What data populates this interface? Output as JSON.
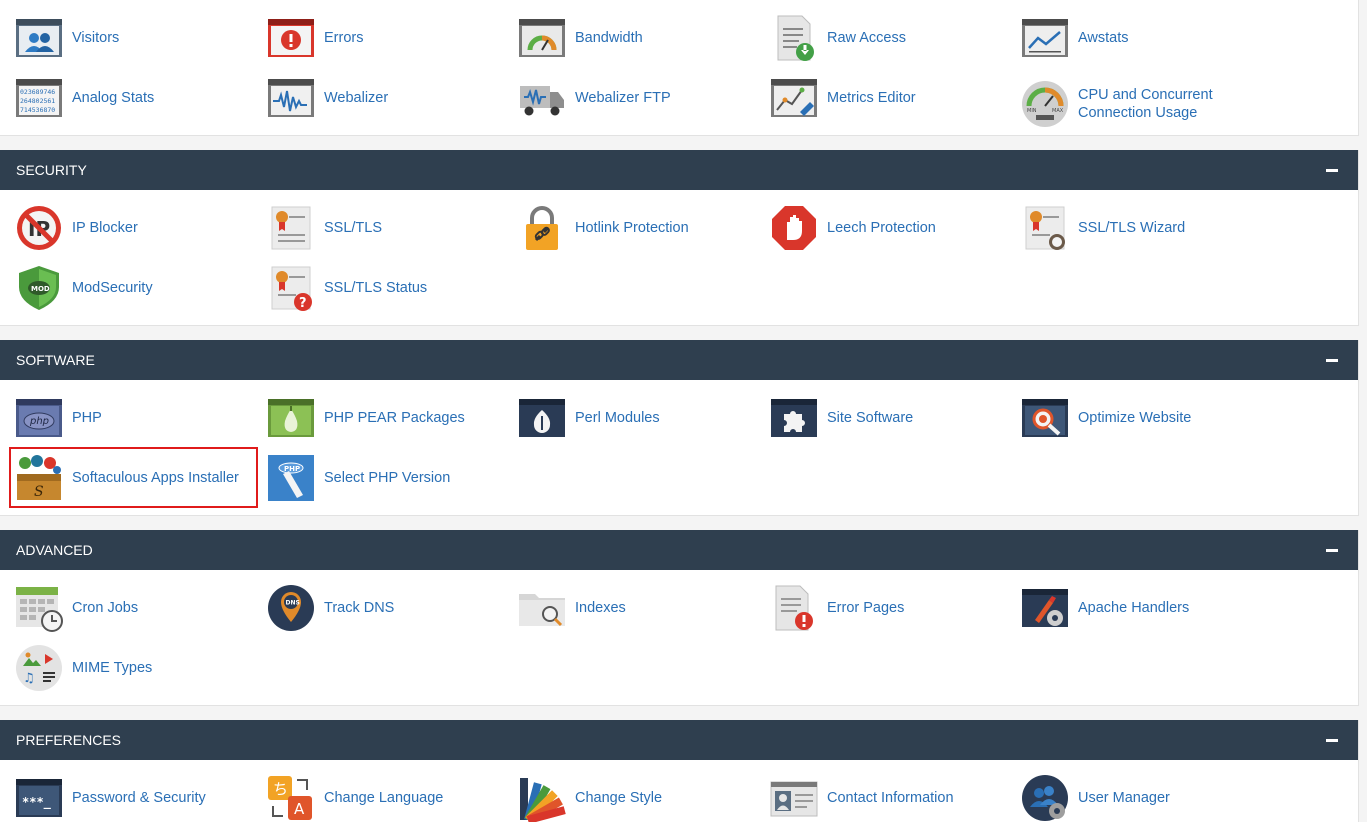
{
  "metrics": {
    "items": [
      {
        "label": "Visitors",
        "icon": "visitors-icon"
      },
      {
        "label": "Errors",
        "icon": "errors-icon"
      },
      {
        "label": "Bandwidth",
        "icon": "bandwidth-icon"
      },
      {
        "label": "Raw Access",
        "icon": "raw-access-icon"
      },
      {
        "label": "Awstats",
        "icon": "awstats-icon"
      },
      {
        "label": "Analog Stats",
        "icon": "analog-stats-icon"
      },
      {
        "label": "Webalizer",
        "icon": "webalizer-icon"
      },
      {
        "label": "Webalizer FTP",
        "icon": "webalizer-ftp-icon"
      },
      {
        "label": "Metrics Editor",
        "icon": "metrics-editor-icon"
      },
      {
        "label": "CPU and Concurrent Connection Usage",
        "icon": "cpu-usage-icon"
      }
    ]
  },
  "security": {
    "title": "SECURITY",
    "items": [
      {
        "label": "IP Blocker",
        "icon": "ip-blocker-icon"
      },
      {
        "label": "SSL/TLS",
        "icon": "ssl-tls-icon"
      },
      {
        "label": "Hotlink Protection",
        "icon": "hotlink-protection-icon"
      },
      {
        "label": "Leech Protection",
        "icon": "leech-protection-icon"
      },
      {
        "label": "SSL/TLS Wizard",
        "icon": "ssl-tls-wizard-icon"
      },
      {
        "label": "ModSecurity",
        "icon": "modsecurity-icon"
      },
      {
        "label": "SSL/TLS Status",
        "icon": "ssl-tls-status-icon"
      }
    ]
  },
  "software": {
    "title": "SOFTWARE",
    "items": [
      {
        "label": "PHP",
        "icon": "php-icon"
      },
      {
        "label": "PHP PEAR Packages",
        "icon": "php-pear-icon"
      },
      {
        "label": "Perl Modules",
        "icon": "perl-modules-icon"
      },
      {
        "label": "Site Software",
        "icon": "site-software-icon"
      },
      {
        "label": "Optimize Website",
        "icon": "optimize-website-icon"
      },
      {
        "label": "Softaculous Apps Installer",
        "icon": "softaculous-icon"
      },
      {
        "label": "Select PHP Version",
        "icon": "select-php-version-icon"
      }
    ]
  },
  "advanced": {
    "title": "ADVANCED",
    "items": [
      {
        "label": "Cron Jobs",
        "icon": "cron-jobs-icon"
      },
      {
        "label": "Track DNS",
        "icon": "track-dns-icon"
      },
      {
        "label": "Indexes",
        "icon": "indexes-icon"
      },
      {
        "label": "Error Pages",
        "icon": "error-pages-icon"
      },
      {
        "label": "Apache Handlers",
        "icon": "apache-handlers-icon"
      },
      {
        "label": "MIME Types",
        "icon": "mime-types-icon"
      }
    ]
  },
  "preferences": {
    "title": "PREFERENCES",
    "items": [
      {
        "label": "Password & Security",
        "icon": "password-security-icon"
      },
      {
        "label": "Change Language",
        "icon": "change-language-icon"
      },
      {
        "label": "Change Style",
        "icon": "change-style-icon"
      },
      {
        "label": "Contact Information",
        "icon": "contact-information-icon"
      },
      {
        "label": "User Manager",
        "icon": "user-manager-icon"
      }
    ]
  },
  "icon_text": {
    "analog_row1": "023689746",
    "analog_row2": "264802561",
    "analog_row3": "714536870",
    "mod": "MOD",
    "php": "php",
    "php_small": "PHP",
    "dns": "DNS",
    "password": "***_",
    "lang_a": "A",
    "lang_b": "ち",
    "cpu_min": "MIN",
    "cpu_max": "MAX"
  }
}
